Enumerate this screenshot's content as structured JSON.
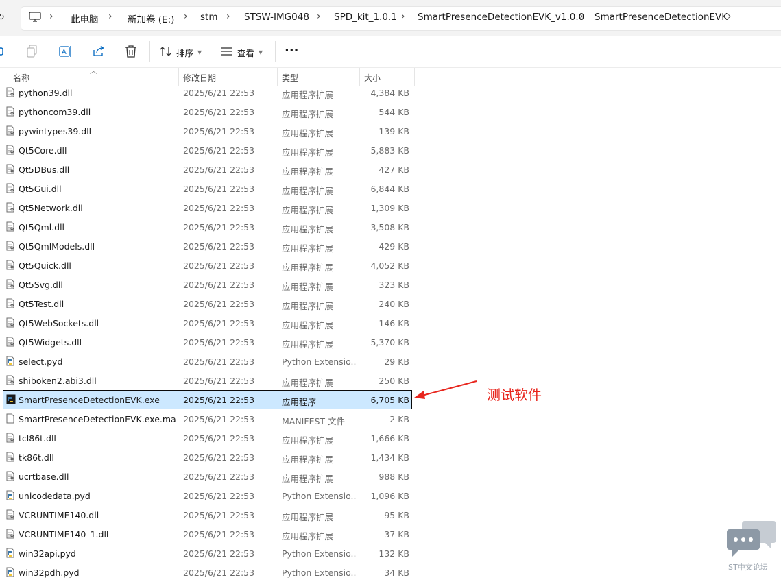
{
  "address_bar": {
    "crumbs": [
      "此电脑",
      "新加卷 (E:)",
      "stm",
      "STSW-IMG048",
      "SPD_kit_1.0.1",
      "SmartPresenceDetectionEVK_v1.0.0",
      "SmartPresenceDetectionEVK"
    ],
    "trailing_chevron": "›"
  },
  "toolbar": {
    "sort_label": "排序",
    "view_label": "查看",
    "more_label": "···",
    "icons": [
      "copy-icon",
      "rename-icon",
      "share-icon",
      "delete-icon",
      "sort-icon",
      "view-icon",
      "more-icon"
    ]
  },
  "columns": {
    "name": "名称",
    "date": "修改日期",
    "type": "类型",
    "size": "大小"
  },
  "files": [
    {
      "name": "python39.dll",
      "date": "2025/6/21 22:53",
      "type": "应用程序扩展",
      "size": "4,384 KB",
      "icon": "dll-file-icon"
    },
    {
      "name": "pythoncom39.dll",
      "date": "2025/6/21 22:53",
      "type": "应用程序扩展",
      "size": "544 KB",
      "icon": "dll-file-icon"
    },
    {
      "name": "pywintypes39.dll",
      "date": "2025/6/21 22:53",
      "type": "应用程序扩展",
      "size": "139 KB",
      "icon": "dll-file-icon"
    },
    {
      "name": "Qt5Core.dll",
      "date": "2025/6/21 22:53",
      "type": "应用程序扩展",
      "size": "5,883 KB",
      "icon": "dll-file-icon"
    },
    {
      "name": "Qt5DBus.dll",
      "date": "2025/6/21 22:53",
      "type": "应用程序扩展",
      "size": "427 KB",
      "icon": "dll-file-icon"
    },
    {
      "name": "Qt5Gui.dll",
      "date": "2025/6/21 22:53",
      "type": "应用程序扩展",
      "size": "6,844 KB",
      "icon": "dll-file-icon"
    },
    {
      "name": "Qt5Network.dll",
      "date": "2025/6/21 22:53",
      "type": "应用程序扩展",
      "size": "1,309 KB",
      "icon": "dll-file-icon"
    },
    {
      "name": "Qt5Qml.dll",
      "date": "2025/6/21 22:53",
      "type": "应用程序扩展",
      "size": "3,508 KB",
      "icon": "dll-file-icon"
    },
    {
      "name": "Qt5QmlModels.dll",
      "date": "2025/6/21 22:53",
      "type": "应用程序扩展",
      "size": "429 KB",
      "icon": "dll-file-icon"
    },
    {
      "name": "Qt5Quick.dll",
      "date": "2025/6/21 22:53",
      "type": "应用程序扩展",
      "size": "4,052 KB",
      "icon": "dll-file-icon"
    },
    {
      "name": "Qt5Svg.dll",
      "date": "2025/6/21 22:53",
      "type": "应用程序扩展",
      "size": "323 KB",
      "icon": "dll-file-icon"
    },
    {
      "name": "Qt5Test.dll",
      "date": "2025/6/21 22:53",
      "type": "应用程序扩展",
      "size": "240 KB",
      "icon": "dll-file-icon"
    },
    {
      "name": "Qt5WebSockets.dll",
      "date": "2025/6/21 22:53",
      "type": "应用程序扩展",
      "size": "146 KB",
      "icon": "dll-file-icon"
    },
    {
      "name": "Qt5Widgets.dll",
      "date": "2025/6/21 22:53",
      "type": "应用程序扩展",
      "size": "5,370 KB",
      "icon": "dll-file-icon"
    },
    {
      "name": "select.pyd",
      "date": "2025/6/21 22:53",
      "type": "Python Extensio...",
      "size": "29 KB",
      "icon": "python-file-icon"
    },
    {
      "name": "shiboken2.abi3.dll",
      "date": "2025/6/21 22:53",
      "type": "应用程序扩展",
      "size": "250 KB",
      "icon": "dll-file-icon"
    },
    {
      "name": "SmartPresenceDetectionEVK.exe",
      "date": "2025/6/21 22:53",
      "type": "应用程序",
      "size": "6,705 KB",
      "icon": "exe-file-icon",
      "selected": true
    },
    {
      "name": "SmartPresenceDetectionEVK.exe.man...",
      "date": "2025/6/21 22:53",
      "type": "MANIFEST 文件",
      "size": "2 KB",
      "icon": "blank-file-icon"
    },
    {
      "name": "tcl86t.dll",
      "date": "2025/6/21 22:53",
      "type": "应用程序扩展",
      "size": "1,666 KB",
      "icon": "dll-file-icon"
    },
    {
      "name": "tk86t.dll",
      "date": "2025/6/21 22:53",
      "type": "应用程序扩展",
      "size": "1,434 KB",
      "icon": "dll-file-icon"
    },
    {
      "name": "ucrtbase.dll",
      "date": "2025/6/21 22:53",
      "type": "应用程序扩展",
      "size": "988 KB",
      "icon": "dll-file-icon"
    },
    {
      "name": "unicodedata.pyd",
      "date": "2025/6/21 22:53",
      "type": "Python Extensio...",
      "size": "1,096 KB",
      "icon": "python-file-icon"
    },
    {
      "name": "VCRUNTIME140.dll",
      "date": "2025/6/21 22:53",
      "type": "应用程序扩展",
      "size": "95 KB",
      "icon": "dll-file-icon"
    },
    {
      "name": "VCRUNTIME140_1.dll",
      "date": "2025/6/21 22:53",
      "type": "应用程序扩展",
      "size": "37 KB",
      "icon": "dll-file-icon"
    },
    {
      "name": "win32api.pyd",
      "date": "2025/6/21 22:53",
      "type": "Python Extensio...",
      "size": "132 KB",
      "icon": "python-file-icon"
    },
    {
      "name": "win32pdh.pyd",
      "date": "2025/6/21 22:53",
      "type": "Python Extensio...",
      "size": "34 KB",
      "icon": "python-file-icon"
    }
  ],
  "annotation": {
    "text": "测试软件",
    "color": "#e8251d"
  },
  "watermark": {
    "text": "ST中文论坛",
    "icon": "chat-bubbles-icon"
  },
  "colors": {
    "selection": "#cce8ff",
    "accent_blue": "#0067c0"
  }
}
